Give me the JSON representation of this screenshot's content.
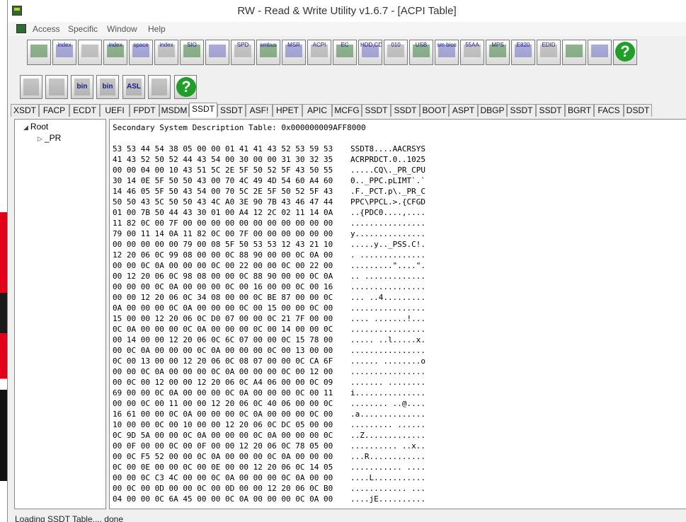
{
  "window": {
    "title": "RW - Read & Write Utility v1.6.7 - [ACPI Table]"
  },
  "menu": {
    "items": [
      "Access",
      "Specific",
      "Window",
      "Help"
    ]
  },
  "toolbar1": {
    "buttons": [
      {
        "icon": "pci-card-icon",
        "label": ""
      },
      {
        "icon": "index-card-icon",
        "label": "index"
      },
      {
        "icon": "memory-icon",
        "label": ""
      },
      {
        "icon": "index-memory-icon",
        "label": "index"
      },
      {
        "icon": "io-space-icon",
        "label": "space"
      },
      {
        "icon": "io-index-icon",
        "label": "index"
      },
      {
        "icon": "sio-icon",
        "label": "SIO"
      },
      {
        "icon": "oscilloscope-icon",
        "label": ""
      },
      {
        "icon": "spd-icon",
        "label": "SPD"
      },
      {
        "icon": "smbus-icon",
        "label": "smbus"
      },
      {
        "icon": "msr-icon",
        "label": "MSR"
      },
      {
        "icon": "acpi-icon",
        "label": "ACPI"
      },
      {
        "icon": "ec-icon",
        "label": "EC"
      },
      {
        "icon": "hdd-cd-icon",
        "label": "HDD,CD"
      },
      {
        "icon": "hex-010-icon",
        "label": "010"
      },
      {
        "icon": "usb-icon",
        "label": "USB"
      },
      {
        "icon": "smbios-icon",
        "label": "sm bios"
      },
      {
        "icon": "55aa-icon",
        "label": "55AA"
      },
      {
        "icon": "mps-icon",
        "label": "MPS"
      },
      {
        "icon": "e820-icon",
        "label": "E820"
      },
      {
        "icon": "edid-icon",
        "label": "EDID"
      },
      {
        "icon": "command-prompt-icon",
        "label": ""
      },
      {
        "icon": "tools-icon",
        "label": ""
      },
      {
        "icon": "help-icon",
        "label": "?"
      }
    ]
  },
  "toolbar2": {
    "buttons": [
      {
        "icon": "save-icon",
        "label": ""
      },
      {
        "icon": "save-all-icon",
        "label": ""
      },
      {
        "icon": "save-bin-icon",
        "label": "bin"
      },
      {
        "icon": "save-all-bin-icon",
        "label": "bin"
      },
      {
        "icon": "asl-icon",
        "label": "ASL"
      },
      {
        "icon": "binoculars-icon",
        "label": ""
      },
      {
        "icon": "help-icon",
        "label": "?"
      }
    ]
  },
  "tabs": [
    "XSDT",
    "FACP",
    "ECDT",
    "UEFI",
    "FPDT",
    "MSDM",
    "SSDT",
    "SSDT",
    "ASF!",
    "HPET",
    "APIC",
    "MCFG",
    "SSDT",
    "SSDT",
    "BOOT",
    "ASPT",
    "DBGP",
    "SSDT",
    "SSDT",
    "BGRT",
    "FACS",
    "DSDT"
  ],
  "active_tab_index": 6,
  "tree": {
    "root": "Root",
    "child": "_PR"
  },
  "table": {
    "title": "Secondary System Description Table: 0x000000009AFF8000",
    "rows": [
      {
        "hex": "53 53 44 54 38 05 00 00 01 41 41 43 52 53 59 53",
        "ascii": "SSDT8....AACRSYS"
      },
      {
        "hex": "41 43 52 50 52 44 43 54 00 30 00 00 31 30 32 35",
        "ascii": "ACRPRDCT.0..1025"
      },
      {
        "hex": "00 00 04 00 10 43 51 5C 2E 5F 50 52 5F 43 50 55",
        "ascii": ".....CQ\\._PR_CPU"
      },
      {
        "hex": "30 14 0E 5F 50 50 43 00 70 4C 49 4D 54 60 A4 60",
        "ascii": "0.._PPC.pLIMT`.`"
      },
      {
        "hex": "14 46 05 5F 50 43 54 00 70 5C 2E 5F 50 52 5F 43",
        "ascii": ".F._PCT.p\\._PR_C"
      },
      {
        "hex": "50 50 43 5C 50 50 43 4C A0 3E 90 7B 43 46 47 44",
        "ascii": "PPC\\PPCL.>.{CFGD"
      },
      {
        "hex": "01 00 7B 50 44 43 30 01 00 A4 12 2C 02 11 14 0A",
        "ascii": "..{PDC0....,...."
      },
      {
        "hex": "11 82 0C 00 7F 00 00 00 00 00 00 00 00 00 00 00",
        "ascii": "................"
      },
      {
        "hex": "79 00 11 14 0A 11 82 0C 00 7F 00 00 00 00 00 00",
        "ascii": "y..............."
      },
      {
        "hex": "00 00 00 00 00 79 00 08 5F 50 53 53 12 43 21 10",
        "ascii": ".....y.._PSS.C!."
      },
      {
        "hex": "12 20 06 0C 99 08 00 00 0C 88 90 00 00 0C 0A 00",
        "ascii": ". .............."
      },
      {
        "hex": "00 00 0C 0A 00 00 00 0C 00 22 00 00 0C 00 22 00",
        "ascii": ".........\"....\"."
      },
      {
        "hex": "00 12 20 06 0C 98 08 00 00 0C 88 90 00 00 0C 0A",
        "ascii": ".. ............."
      },
      {
        "hex": "00 00 00 0C 0A 00 00 00 0C 00 16 00 00 0C 00 16",
        "ascii": "................"
      },
      {
        "hex": "00 00 12 20 06 0C 34 08 00 00 0C BE 87 00 00 0C",
        "ascii": "... ..4........."
      },
      {
        "hex": "0A 00 00 00 0C 0A 00 00 00 0C 00 15 00 00 0C 00",
        "ascii": "................"
      },
      {
        "hex": "15 00 00 12 20 06 0C D0 07 00 00 0C 21 7F 00 00",
        "ascii": ".... .......!..."
      },
      {
        "hex": "0C 0A 00 00 00 0C 0A 00 00 00 0C 00 14 00 00 0C",
        "ascii": "................"
      },
      {
        "hex": "00 14 00 00 12 20 06 0C 6C 07 00 00 0C 15 78 00",
        "ascii": "..... ..l.....x."
      },
      {
        "hex": "00 0C 0A 00 00 00 0C 0A 00 00 00 0C 00 13 00 00",
        "ascii": "................"
      },
      {
        "hex": "0C 00 13 00 00 12 20 06 0C 08 07 00 00 0C CA 6F",
        "ascii": "...... ........o"
      },
      {
        "hex": "00 00 0C 0A 00 00 00 0C 0A 00 00 00 0C 00 12 00",
        "ascii": "................"
      },
      {
        "hex": "00 0C 00 12 00 00 12 20 06 0C A4 06 00 00 0C 09",
        "ascii": "....... ........"
      },
      {
        "hex": "69 00 00 0C 0A 00 00 00 0C 0A 00 00 00 0C 00 11",
        "ascii": "i..............."
      },
      {
        "hex": "00 00 0C 00 11 00 00 12 20 06 0C 40 06 00 00 0C",
        "ascii": "........ ..@...."
      },
      {
        "hex": "16 61 00 00 0C 0A 00 00 00 0C 0A 00 00 00 0C 00",
        "ascii": ".a.............."
      },
      {
        "hex": "10 00 00 0C 00 10 00 00 12 20 06 0C DC 05 00 00",
        "ascii": "......... ......"
      },
      {
        "hex": "0C 9D 5A 00 00 0C 0A 00 00 00 0C 0A 00 00 00 0C",
        "ascii": "..Z............."
      },
      {
        "hex": "00 0F 00 00 0C 00 0F 00 00 12 20 06 0C 78 05 00",
        "ascii": ".......... ..x.."
      },
      {
        "hex": "00 0C F5 52 00 00 0C 0A 00 00 00 0C 0A 00 00 00",
        "ascii": "...R............"
      },
      {
        "hex": "0C 00 0E 00 00 0C 00 0E 00 00 12 20 06 0C 14 05",
        "ascii": "........... ...."
      },
      {
        "hex": "00 00 0C C3 4C 00 00 0C 0A 00 00 00 0C 0A 00 00",
        "ascii": "....L..........."
      },
      {
        "hex": "00 0C 00 0D 00 00 0C 00 0D 00 00 12 20 06 0C B0",
        "ascii": "............ ..."
      },
      {
        "hex": "04 00 00 0C 6A 45 00 00 0C 0A 00 00 00 0C 0A 00",
        "ascii": "....jE.........."
      }
    ]
  },
  "status": {
    "text": "Loading SSDT Table.... done"
  },
  "colors": {
    "help_green": "#1f9e2a",
    "desktop_red": "#e3001b"
  }
}
